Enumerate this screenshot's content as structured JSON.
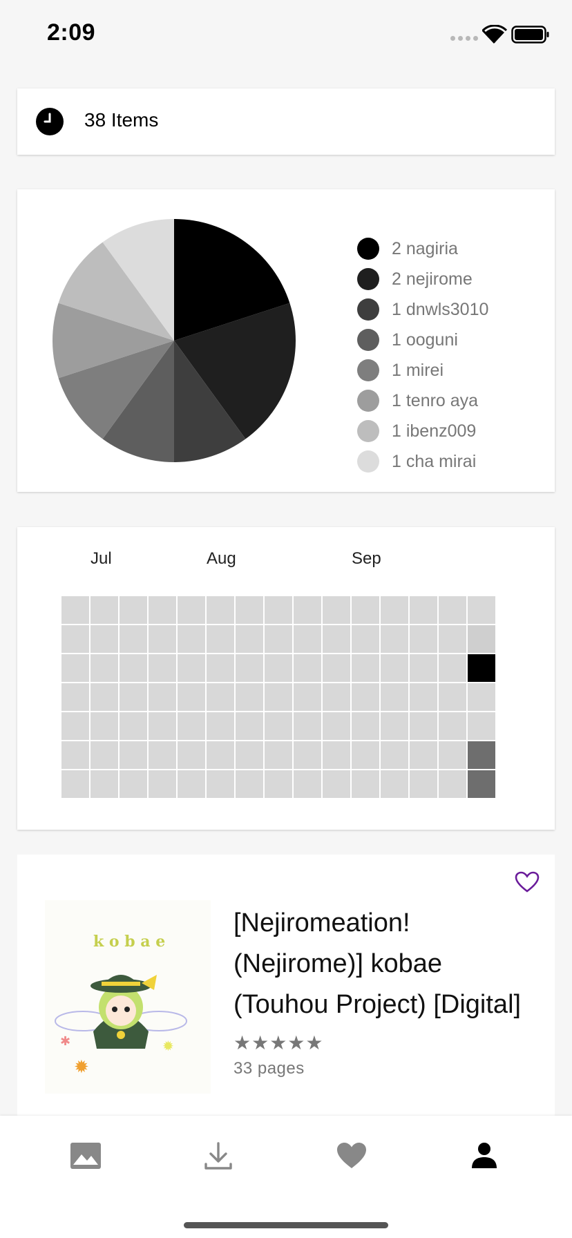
{
  "status_bar": {
    "time": "2:09"
  },
  "history": {
    "count_text": "38 Items"
  },
  "pie_chart": {
    "slices": [
      {
        "label": "2 nagiria",
        "value": 2,
        "color": "#000000"
      },
      {
        "label": "2 nejirome",
        "value": 2,
        "color": "#1f1f1f"
      },
      {
        "label": "1 dnwls3010",
        "value": 1,
        "color": "#3e3e3e"
      },
      {
        "label": "1 ooguni",
        "value": 1,
        "color": "#5e5e5e"
      },
      {
        "label": "1 mirei",
        "value": 1,
        "color": "#7e7e7e"
      },
      {
        "label": "1 tenro aya",
        "value": 1,
        "color": "#9d9d9d"
      },
      {
        "label": "1 ibenz009",
        "value": 1,
        "color": "#bdbdbd"
      },
      {
        "label": "1 cha mirai",
        "value": 1,
        "color": "#dcdcdc"
      }
    ]
  },
  "calendar": {
    "months": [
      "Jul",
      "Aug",
      "Sep"
    ],
    "weeks": 15,
    "days": 7,
    "empty_color": "#d8d8d8",
    "highlights": [
      {
        "week": 14,
        "day": 1,
        "color": "#cfcfcf"
      },
      {
        "week": 14,
        "day": 2,
        "color": "#000000"
      },
      {
        "week": 14,
        "day": 5,
        "color": "#6e6e6e"
      },
      {
        "week": 14,
        "day": 6,
        "color": "#6e6e6e"
      }
    ]
  },
  "gallery": {
    "title": "[Nejiromeation! (Nejirome)] kobae (Touhou Project) [Digital]",
    "rating": "★★★★★",
    "pages": "33 pages",
    "thumbnail_text": "k o b a e",
    "accent_color": "#6a1b9a"
  },
  "bottom_nav": {
    "items": [
      {
        "icon": "image-icon",
        "color": "#888888"
      },
      {
        "icon": "download-icon",
        "color": "#888888"
      },
      {
        "icon": "heart-icon",
        "color": "#888888"
      },
      {
        "icon": "person-icon",
        "color": "#000000",
        "active": true
      }
    ]
  }
}
